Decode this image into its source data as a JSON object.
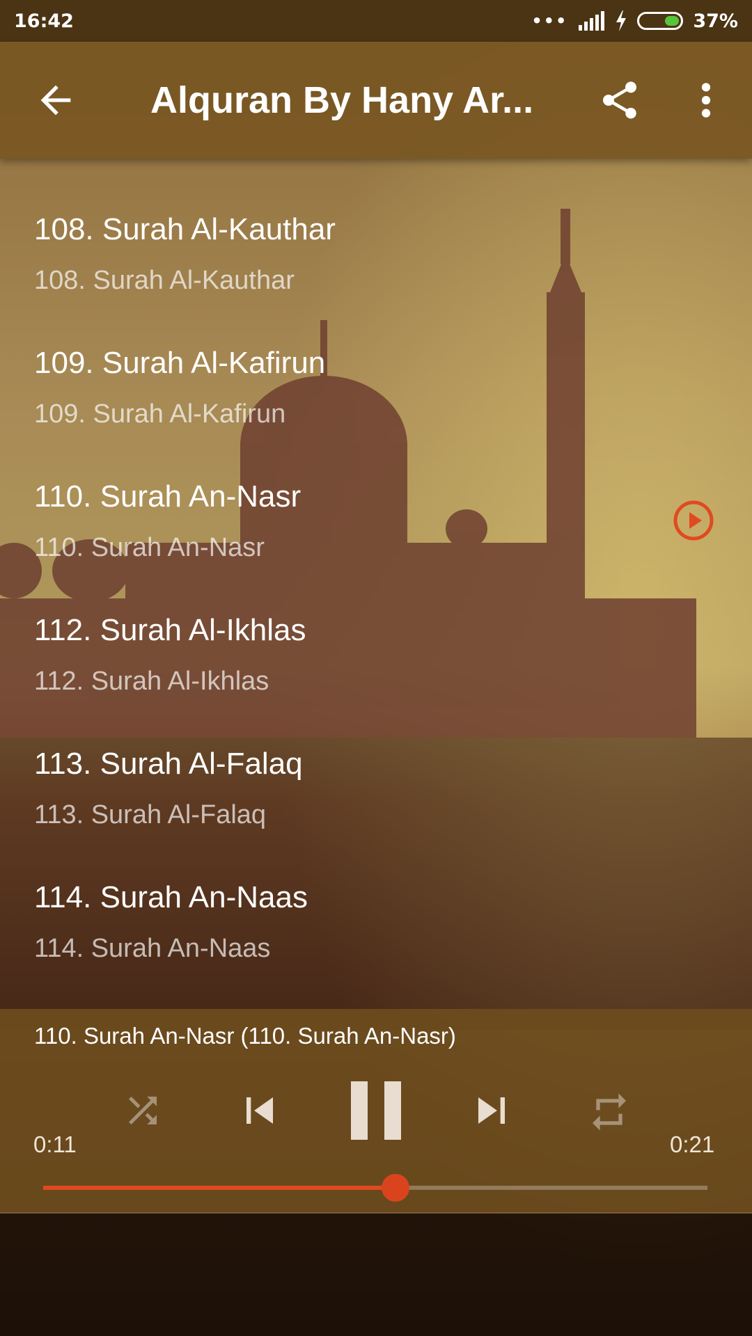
{
  "status_bar": {
    "time": "16:42",
    "battery": "37%",
    "battery_level": 0.37
  },
  "toolbar": {
    "title": "Alquran By Hany Ar..."
  },
  "tracks": [
    {
      "title": "108. Surah Al-Kauthar",
      "subtitle": "108. Surah Al-Kauthar",
      "playing": false
    },
    {
      "title": "109. Surah Al-Kafirun",
      "subtitle": "109. Surah Al-Kafirun",
      "playing": false
    },
    {
      "title": "110. Surah An-Nasr",
      "subtitle": "110. Surah An-Nasr",
      "playing": true
    },
    {
      "title": "112. Surah Al-Ikhlas",
      "subtitle": "112. Surah Al-Ikhlas",
      "playing": false
    },
    {
      "title": "113. Surah Al-Falaq",
      "subtitle": "113. Surah Al-Falaq",
      "playing": false
    },
    {
      "title": "114. Surah An-Naas",
      "subtitle": "114. Surah An-Naas",
      "playing": false
    }
  ],
  "player": {
    "now_playing": "110. Surah An-Nasr (110. Surah An-Nasr)",
    "elapsed": "0:11",
    "duration": "0:21",
    "progress": 0.53
  },
  "icons": {
    "back": "arrow-left-icon",
    "share": "share-icon",
    "more": "more-vert-icon",
    "shuffle": "shuffle-icon",
    "previous": "skip-previous-icon",
    "pause": "pause-icon",
    "next": "skip-next-icon",
    "repeat": "repeat-icon",
    "playing_indicator": "play-circle-icon"
  },
  "colors": {
    "toolbar": "#785622",
    "accent": "#e04a20",
    "player_bg": "#6e4e1e"
  }
}
